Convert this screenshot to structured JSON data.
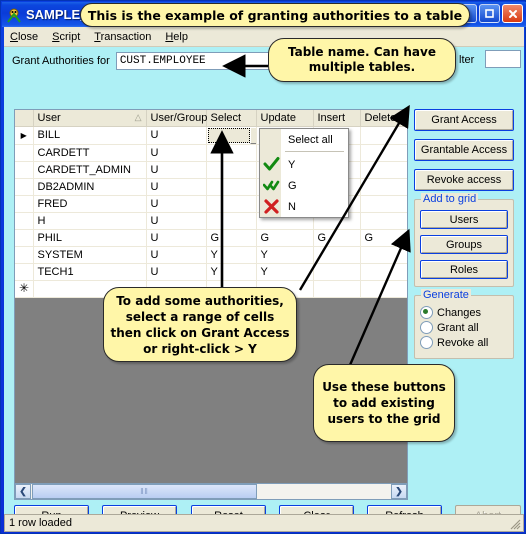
{
  "window": {
    "title": "SAMPLE_",
    "icon": "app-icon",
    "buttons": {
      "minimize": "_",
      "maximize": "❐",
      "close": "✕"
    }
  },
  "menubar": {
    "items": [
      {
        "label": "Close",
        "accel": "C"
      },
      {
        "label": "Script",
        "accel": "S"
      },
      {
        "label": "Transaction",
        "accel": "T"
      },
      {
        "label": "Help",
        "accel": "H"
      }
    ]
  },
  "toolbar": {
    "grant_label": "Grant Authorities for",
    "table_name": "CUST.EMPLOYEE",
    "filter_label": "lter",
    "filter_value": ""
  },
  "grid": {
    "columns": [
      "",
      "User",
      "User/Group",
      "Select",
      "Update",
      "Insert",
      "Delete"
    ],
    "sort_column": "User",
    "sort_mark": "△",
    "rows": [
      {
        "marker": "▶",
        "user": "BILL",
        "usergroup": "U",
        "select": "",
        "update": "",
        "insert": "",
        "delete": "",
        "select_combo": true,
        "select_highlight": false,
        "update_highlight": false
      },
      {
        "marker": "",
        "user": "CARDETT",
        "usergroup": "U",
        "select": "",
        "update": "",
        "insert": "",
        "delete": "",
        "select_combo": false,
        "select_highlight": false,
        "update_highlight": false
      },
      {
        "marker": "",
        "user": "CARDETT_ADMIN",
        "usergroup": "U",
        "select": "",
        "update": "",
        "insert": "",
        "delete": "",
        "select_combo": false,
        "select_highlight": false,
        "update_highlight": false
      },
      {
        "marker": "",
        "user": "DB2ADMIN",
        "usergroup": "U",
        "select": "",
        "update": "",
        "insert": "",
        "delete": "",
        "select_combo": false,
        "select_highlight": false,
        "update_highlight": false
      },
      {
        "marker": "",
        "user": "FRED",
        "usergroup": "U",
        "select": "",
        "update": "",
        "insert": "",
        "delete": "",
        "select_combo": false,
        "select_highlight": false,
        "update_highlight": false
      },
      {
        "marker": "",
        "user": "H",
        "usergroup": "U",
        "select": "",
        "update": "",
        "insert": "",
        "delete": "",
        "select_combo": false,
        "select_highlight": false,
        "update_highlight": false
      },
      {
        "marker": "",
        "user": "PHIL",
        "usergroup": "U",
        "select": "G",
        "update": "G",
        "insert": "G",
        "delete": "G",
        "select_combo": false,
        "select_highlight": false,
        "update_highlight": false
      },
      {
        "marker": "",
        "user": "SYSTEM",
        "usergroup": "U",
        "select": "Y",
        "update": "Y",
        "insert": "",
        "delete": "",
        "select_combo": false,
        "select_highlight": true,
        "update_highlight": true
      },
      {
        "marker": "",
        "user": "TECH1",
        "usergroup": "U",
        "select": "Y",
        "update": "Y",
        "insert": "",
        "delete": "",
        "select_combo": false,
        "select_highlight": true,
        "update_highlight": true
      }
    ],
    "new_row_marker": "✳"
  },
  "context_menu": {
    "header": "Select all",
    "items": [
      {
        "icon": "green-check-icon",
        "label": "Y"
      },
      {
        "icon": "green-double-check-icon",
        "label": "G"
      },
      {
        "icon": "red-cross-icon",
        "label": "N"
      }
    ]
  },
  "right_panel": {
    "buttons": [
      {
        "label": "Grant Access"
      },
      {
        "label": "Grantable Access"
      },
      {
        "label": "Revoke access"
      }
    ],
    "add_to_grid": {
      "title": "Add to grid",
      "buttons": [
        "Users",
        "Groups",
        "Roles"
      ]
    },
    "generate": {
      "title": "Generate",
      "options": [
        {
          "label": "Changes",
          "selected": true
        },
        {
          "label": "Grant all",
          "selected": false
        },
        {
          "label": "Revoke all",
          "selected": false
        }
      ]
    }
  },
  "scrollbar": {
    "left_arrow": "❮",
    "right_arrow": "❯",
    "grip": "‖‖"
  },
  "bottom_buttons": [
    {
      "label": "Run",
      "disabled": false
    },
    {
      "label": "Preview",
      "disabled": false
    },
    {
      "label": "Reset",
      "disabled": false
    },
    {
      "label": "Clear",
      "disabled": false
    },
    {
      "label": "Refresh",
      "disabled": false
    },
    {
      "label": "Abort",
      "disabled": true
    }
  ],
  "statusbar": {
    "text": "1 row loaded"
  },
  "annotations": {
    "title_callout": "This is the example of granting authorities to a table",
    "tablename_callout": "Table name. Can have multiple tables.",
    "grant_callout": "To add some authorities, select a range of cells then click on Grant Access or right-click > Y",
    "addusers_callout": "Use these buttons to add existing users to the grid"
  },
  "colors": {
    "accent": "#0A3FE0",
    "client_bg": "#AEF0F5",
    "control_bg": "#ECE9D8",
    "highlight": "#FFFF00",
    "callout_bg": "#FFF6A8"
  }
}
